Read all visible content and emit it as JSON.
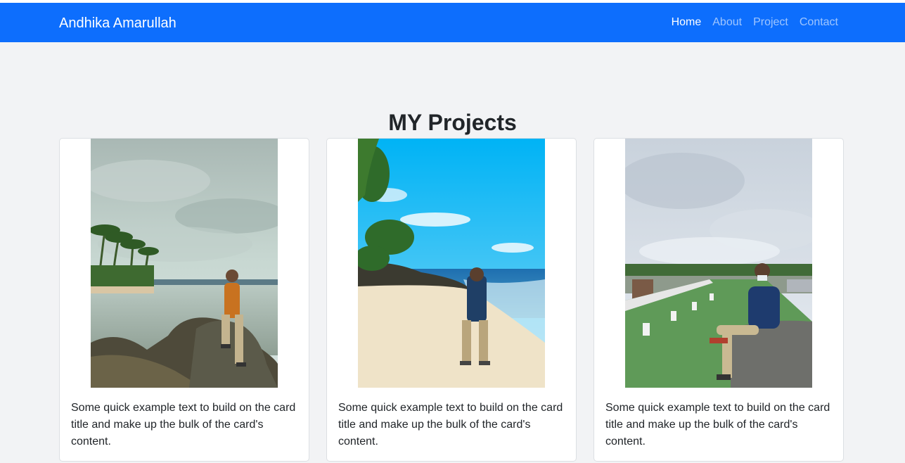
{
  "navbar": {
    "brand": "Andhika Amarullah",
    "links": [
      {
        "label": "Home"
      },
      {
        "label": "About"
      },
      {
        "label": "Project"
      },
      {
        "label": "Contact"
      }
    ],
    "color": "#0d6efd"
  },
  "main": {
    "title": "MY Projects",
    "cards": [
      {
        "photo": "beach-rocks-photo",
        "text": "Some quick example text to build on the card title and make up the bulk of the card's content."
      },
      {
        "photo": "beach-sand-photo",
        "text": "Some quick example text to build on the card title and make up the bulk of the card's content."
      },
      {
        "photo": "rooftop-photo",
        "text": "Some quick example text to build on the card title and make up the bulk of the card's content."
      }
    ]
  }
}
